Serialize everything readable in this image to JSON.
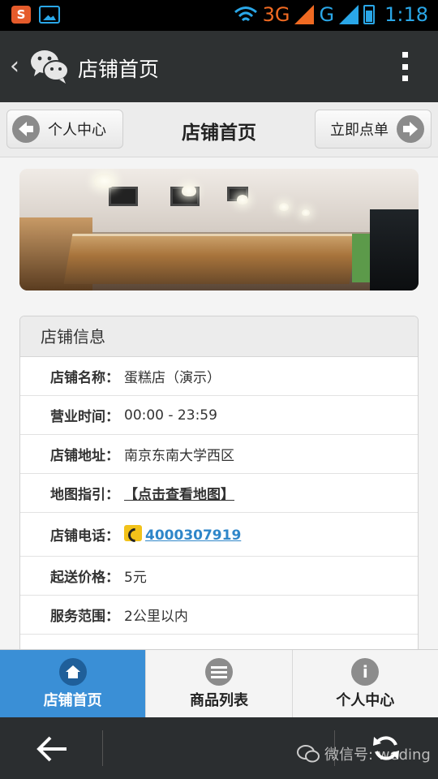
{
  "status_bar": {
    "app_icon_letter": "S",
    "network_3g": "3G",
    "network_g": "G",
    "time": "1:18"
  },
  "wechat_bar": {
    "title": "店铺首页"
  },
  "page_header": {
    "left_button": "个人中心",
    "title": "店铺首页",
    "right_button": "立即点单"
  },
  "store_info": {
    "heading": "店铺信息",
    "rows": [
      {
        "label": "店铺名称：",
        "value": "蛋糕店（演示）"
      },
      {
        "label": "营业时间：",
        "value": "00:00 - 23:59"
      },
      {
        "label": "店铺地址：",
        "value": "南京东南大学西区"
      },
      {
        "label": "地图指引：",
        "value": "【点击查看地图】"
      },
      {
        "label": "店铺电话：",
        "value": "4000307919"
      },
      {
        "label": "起送价格：",
        "value": "5元"
      },
      {
        "label": "服务范围：",
        "value": "2公里以内"
      }
    ]
  },
  "tabs": [
    {
      "label": "店铺首页",
      "icon": "home-icon",
      "active": true
    },
    {
      "label": "商品列表",
      "icon": "list-icon",
      "active": false
    },
    {
      "label": "个人中心",
      "icon": "info-icon",
      "active": false
    }
  ],
  "nav_bar": {
    "watermark": "微信号: weding"
  },
  "colors": {
    "active_tab": "#3a8fd6",
    "link": "#2f86c9",
    "title_bar": "#2e3132"
  }
}
